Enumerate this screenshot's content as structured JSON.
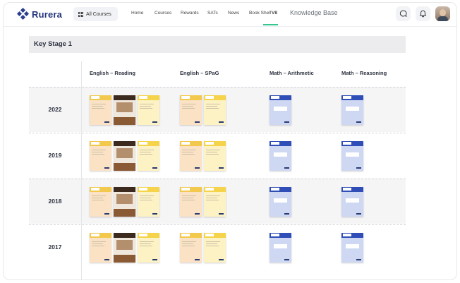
{
  "header": {
    "logo_text": "Rurera",
    "courses_button": "All Courses",
    "nav": [
      "Home",
      "Courses",
      "Rewards",
      "SATs",
      "News",
      "Book Shelf"
    ],
    "nav_badge": "V8",
    "knowledge_base": "Knowledge Base",
    "icons": [
      "grid-icon",
      "chat-icon",
      "bell-icon",
      "avatar"
    ],
    "accent_color": "#35c58f",
    "brand_color": "#263681"
  },
  "main": {
    "stage_title": "Key Stage 1",
    "columns": [
      "English – Reading",
      "English – SPaG",
      "Math – Arithmetic",
      "Math – Reasoning"
    ],
    "rows": [
      {
        "year": "2022"
      },
      {
        "year": "2019"
      },
      {
        "year": "2018"
      },
      {
        "year": "2017"
      }
    ],
    "cover_styles": {
      "english_reading": [
        "orange",
        "photo",
        "yellow"
      ],
      "english_spag": [
        "orange",
        "yellow"
      ],
      "math_arithmetic": [
        "blue"
      ],
      "math_reasoning": [
        "blue"
      ]
    }
  }
}
